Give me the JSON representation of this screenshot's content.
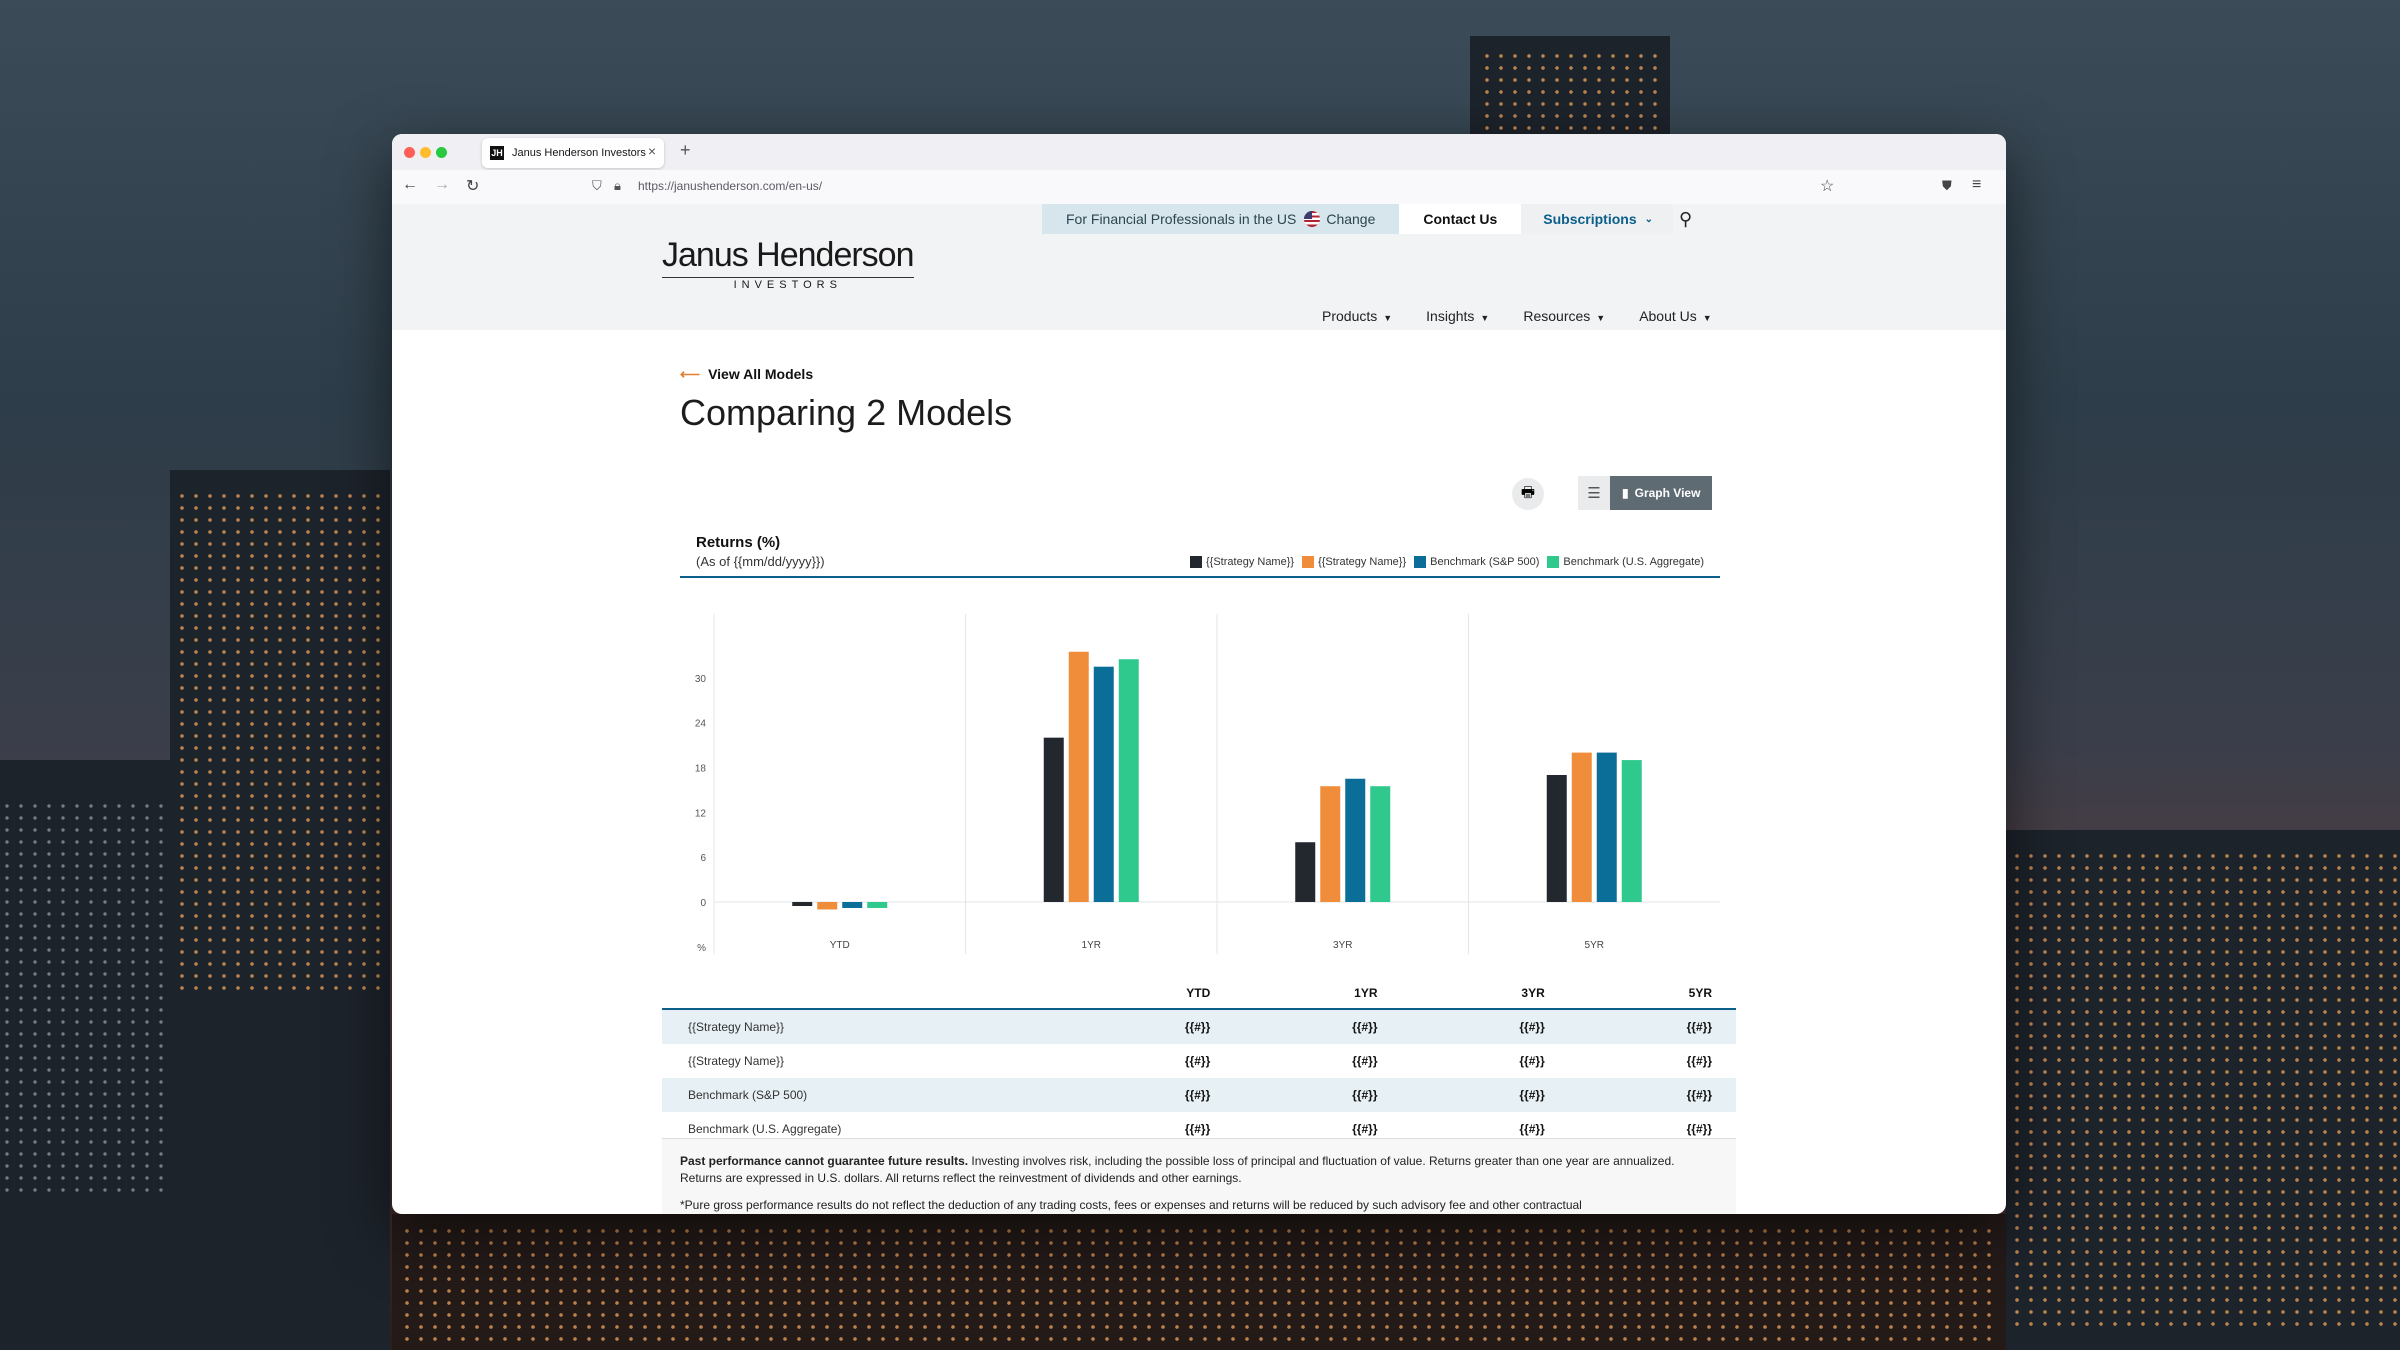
{
  "browser": {
    "tab_title": "Janus Henderson Investors",
    "favicon_letter": "JH",
    "url": "https://janushenderson.com/en-us/"
  },
  "header": {
    "audience_text": "For Financial Professionals in the US",
    "change_label": "Change",
    "contact_label": "Contact Us",
    "subscriptions_label": "Subscriptions",
    "logo_main": "Janus Henderson",
    "logo_sub": "INVESTORS",
    "nav": [
      "Products",
      "Insights",
      "Resources",
      "About Us"
    ]
  },
  "page": {
    "back_label": "View All Models",
    "title": "Comparing 2 Models",
    "graph_view_label": "Graph View"
  },
  "returns": {
    "title": "Returns (%)",
    "as_of": "(As of {{mm/dd/yyyy}})",
    "legend": [
      "{{Strategy Name}}",
      "{{Strategy Name}}",
      "Benchmark (S&P 500)",
      "Benchmark (U.S. Aggregate)"
    ]
  },
  "chart_data": {
    "type": "bar",
    "categories": [
      "YTD",
      "1YR",
      "3YR",
      "5YR"
    ],
    "series": [
      {
        "name": "{{Strategy Name}}",
        "color": "#23272e",
        "values": [
          -0.5,
          22,
          8,
          17
        ]
      },
      {
        "name": "{{Strategy Name}}",
        "color": "#f08d3a",
        "values": [
          -1,
          33.5,
          15.5,
          20
        ]
      },
      {
        "name": "Benchmark (S&P 500)",
        "color": "#0b6e99",
        "values": [
          -0.8,
          31.5,
          16.5,
          20
        ]
      },
      {
        "name": "Benchmark (U.S. Aggregate)",
        "color": "#2fc98e",
        "values": [
          -0.8,
          32.5,
          15.5,
          19
        ]
      }
    ],
    "yticks": [
      "30",
      "24",
      "18",
      "12",
      "6",
      "0",
      "%"
    ],
    "ylim": [
      -7,
      34
    ],
    "grid": "vertical-separators"
  },
  "table": {
    "headers": [
      "",
      "YTD",
      "1YR",
      "3YR",
      "5YR"
    ],
    "rows": [
      {
        "name": "{{Strategy Name}}",
        "values": [
          "{{#}}",
          "{{#}}",
          "{{#}}",
          "{{#}}"
        ]
      },
      {
        "name": "{{Strategy Name}}",
        "values": [
          "{{#}}",
          "{{#}}",
          "{{#}}",
          "{{#}}"
        ]
      },
      {
        "name": "Benchmark (S&P 500)",
        "values": [
          "{{#}}",
          "{{#}}",
          "{{#}}",
          "{{#}}"
        ]
      },
      {
        "name": "Benchmark (U.S. Aggregate)",
        "values": [
          "{{#}}",
          "{{#}}",
          "{{#}}",
          "{{#}}"
        ]
      }
    ]
  },
  "disclaimer": {
    "bold": "Past performance cannot guarantee future results.",
    "text": " Investing involves risk, including the possible loss of principal and fluctuation of value. Returns greater than one year are annualized. Returns are expressed in U.S. dollars. All returns reflect the reinvestment of dividends and other earnings.",
    "footnote": "*Pure gross performance results do not reflect the deduction of any trading costs, fees or expenses and returns will be reduced by such advisory fee and other contractual"
  }
}
